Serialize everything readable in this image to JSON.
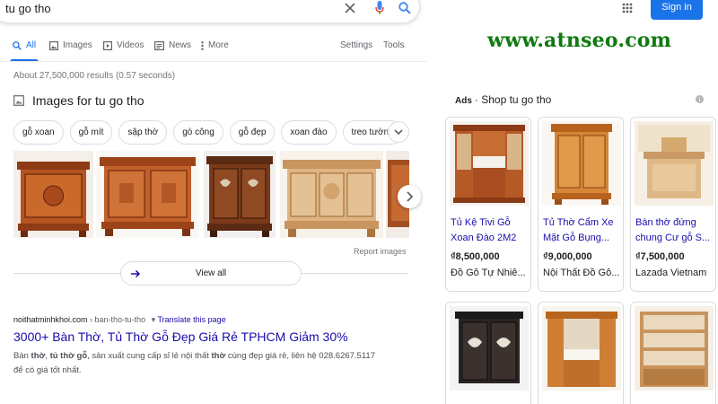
{
  "search": {
    "query": "tu go tho"
  },
  "header": {
    "signin_label": "Sign in"
  },
  "tabs": [
    {
      "label": "All",
      "icon": "search-icon",
      "active": true
    },
    {
      "label": "Images",
      "icon": "image-icon"
    },
    {
      "label": "Videos",
      "icon": "video-icon"
    },
    {
      "label": "News",
      "icon": "news-icon"
    },
    {
      "label": "More",
      "icon": "more-dots-icon"
    }
  ],
  "tools": {
    "settings": "Settings",
    "tools": "Tools"
  },
  "watermark": "www.atnseo.com",
  "stats": "About 27,500,000 results (0.57 seconds)",
  "images_section": {
    "heading": "Images for tu go tho",
    "chips": [
      "gỗ xoan",
      "gỗ mít",
      "sập thờ",
      "gò công",
      "gỗ đẹp",
      "xoan đào",
      "treo tường"
    ],
    "report_label": "Report images",
    "view_all_label": "View all"
  },
  "result": {
    "domain": "noithatminhkhoi.com",
    "path": " › ban-tho-tu-tho",
    "translate": "Translate this page",
    "title": "3000+ Bàn Thờ, Tủ Thờ Gỗ Đẹp Giá Rẻ TPHCM Giảm 30%",
    "snippet_1a": "Bàn ",
    "snippet_1b": "thờ",
    "snippet_1c": ", ",
    "snippet_1d": "tủ thờ gỗ",
    "snippet_1e": ", sản xuất cung cấp sỉ lẻ nội thất ",
    "snippet_1f": "thờ",
    "snippet_1g": " cúng đẹp giá rẻ, liên hệ 028.6267.5117",
    "snippet_2": "để có giá tốt nhất."
  },
  "shop": {
    "ads_label": "Ads",
    "title": "· Shop tu go tho",
    "products": [
      {
        "title_1": "Tủ Kệ Tivi Gỗ",
        "title_2": "Xoan Đào 2M2",
        "price": "₫8,500,000",
        "seller": "Đồ Gỗ Tự Nhiê..."
      },
      {
        "title_1": "Tủ Thờ Cẩm Xe",
        "title_2": "Mặt Gỗ Bụng...",
        "price": "₫9,000,000",
        "seller": "Nội Thất Đồ Gỗ..."
      },
      {
        "title_1": "Bàn thờ đứng",
        "title_2": "chung Cư gỗ S...",
        "price": "₫7,500,000",
        "seller": "Lazada Vietnam"
      }
    ]
  },
  "colors": {
    "link": "#1a0dab",
    "accent": "#1a73e8",
    "watermark": "#107a10",
    "wood": "#a0522d"
  }
}
